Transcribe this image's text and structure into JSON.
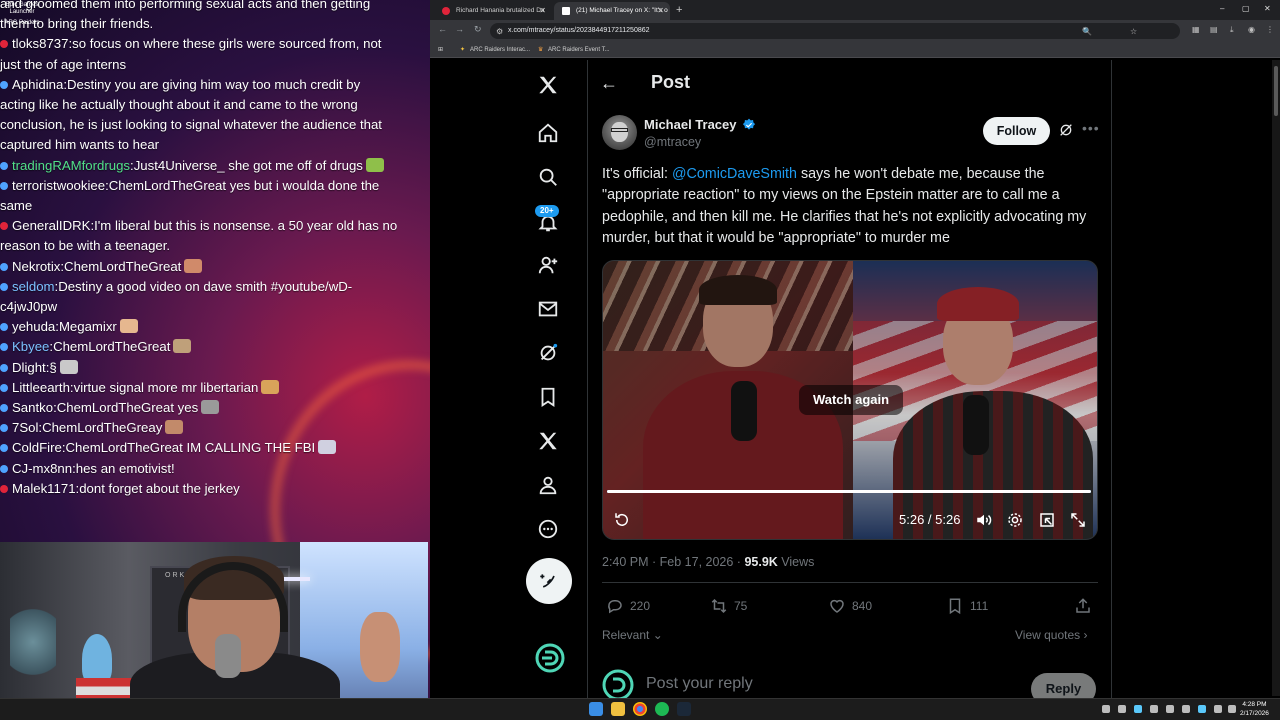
{
  "chat": {
    "lines": [
      {
        "kind": "cont",
        "user": "",
        "msg": "and groomed them into performing sexual acts and then getting"
      },
      {
        "kind": "cont",
        "user": "",
        "msg": "them to bring their friends."
      },
      {
        "kind": "red",
        "user": "tloks8737",
        "msg": "so focus on where these girls were sourced from, not"
      },
      {
        "kind": "cont",
        "user": "",
        "msg": "just the of age interns"
      },
      {
        "kind": "blue",
        "user": "Aphidina",
        "msg": "Destiny you are giving him way too much credit by"
      },
      {
        "kind": "cont",
        "user": "",
        "msg": "acting like he actually thought about it and came to the wrong"
      },
      {
        "kind": "cont",
        "user": "",
        "msg": "conclusion, he is just looking to signal whatever the audience that"
      },
      {
        "kind": "cont",
        "user": "",
        "msg": "captured him wants to hear"
      },
      {
        "kind": "blue",
        "user": "tradingRAMfordrugs",
        "userColor": "green",
        "msg": "Just4Universe_ she got me off of drugs"
      },
      {
        "kind": "blue",
        "user": "terroristwookiee",
        "msg": "ChemLordTheGreat yes but i woulda done the"
      },
      {
        "kind": "cont",
        "user": "",
        "msg": "same"
      },
      {
        "kind": "red",
        "user": "GeneralIDRK",
        "msg": "I'm liberal but this is nonsense. a 50 year old has no"
      },
      {
        "kind": "cont",
        "user": "",
        "msg": "reason to be with a teenager."
      },
      {
        "kind": "blue",
        "user": "Nekrotix",
        "msg": "ChemLordTheGreat"
      },
      {
        "kind": "blue",
        "user": "seldom",
        "userColor": "blue",
        "msg": "Destiny a good video on dave smith #youtube/wD-"
      },
      {
        "kind": "cont",
        "user": "",
        "msg": "c4jwJ0pw"
      },
      {
        "kind": "blue",
        "user": "yehuda",
        "msg": "Megamixr"
      },
      {
        "kind": "blue",
        "user": "Kbyee",
        "userColor": "blue",
        "msg": "ChemLordTheGreat"
      },
      {
        "kind": "blue",
        "user": "Dlight",
        "msg": "§"
      },
      {
        "kind": "blue",
        "user": "Littleearth",
        "msg": "virtue signal more mr libertarian"
      },
      {
        "kind": "blue",
        "user": "Santko",
        "msg": "ChemLordTheGreat yes"
      },
      {
        "kind": "blue",
        "user": "7Sol",
        "msg": "ChemLordTheGreay"
      },
      {
        "kind": "blue",
        "user": "ColdFire",
        "msg": "ChemLordTheGreat IM CALLING THE FBI"
      },
      {
        "kind": "blue",
        "user": "CJ-mx8nn",
        "msg": "hes an emotivist!"
      },
      {
        "kind": "red",
        "user": "Malek1171",
        "msg": "dont forget about the jerkey"
      }
    ],
    "emote_after": [
      8,
      13,
      16,
      17,
      18,
      19,
      20,
      21,
      22
    ]
  },
  "desktop": {
    "icons": [
      "Epic Games Launcher",
      "ARC Raiders"
    ]
  },
  "webcam": {
    "shelf_text": "ORK RAYNE"
  },
  "browser": {
    "tabs": [
      {
        "title": "Richard Hanania brutalized Da",
        "favicon_color": "#e0243a",
        "active": false
      },
      {
        "title": "(21) Michael Tracey on X: \"It's o",
        "favicon_color": "#ffffff",
        "active": true
      }
    ],
    "new_tab": "+",
    "url": "x.com/mtracey/status/2023844917211250862",
    "bookmarks": [
      "ARC Raiders Interac...",
      "ARC Raiders Event T..."
    ],
    "window_controls": [
      "–",
      "▢",
      "✕"
    ]
  },
  "x": {
    "nav": [
      "x-logo",
      "home",
      "explore",
      "notifications",
      "follow",
      "messages",
      "grok",
      "bookmarks",
      "premium",
      "profile",
      "more"
    ],
    "notif_badge": "20+",
    "header_title": "Post",
    "post": {
      "author_name": "Michael Tracey",
      "author_handle": "@mtracey",
      "follow_label": "Follow",
      "text_before": "It's official: ",
      "mention": "@ComicDaveSmith",
      "text_after": " says he won't debate me, because the \"appropriate reaction\" to my views on the Epstein matter are to call me a pedophile, and then kill me. He clarifies that he's not explicitly advocating my murder, but that it would be \"appropriate\" to murder me",
      "video": {
        "overlay_label": "Watch again",
        "time": "5:26 / 5:26",
        "progress": 1.0
      },
      "time_text": "2:40 PM · Feb 17, 2026 · ",
      "views_count": "95.9K",
      "views_label": " Views",
      "stats": {
        "replies": "220",
        "reposts": "75",
        "likes": "840",
        "bookmarks": "111"
      },
      "sort_label": "Relevant",
      "view_quotes": "View quotes",
      "reply_placeholder": "Post your reply",
      "reply_button": "Reply"
    }
  },
  "taskbar": {
    "clock_time": "4:28 PM",
    "clock_date": "2/17/2026"
  },
  "colors": {
    "x_blue": "#1d9bf0",
    "x_text": "#e7e9ea",
    "x_muted": "#71767b",
    "chat_red": "#e0243a",
    "chat_blue": "#4fa3ff"
  }
}
